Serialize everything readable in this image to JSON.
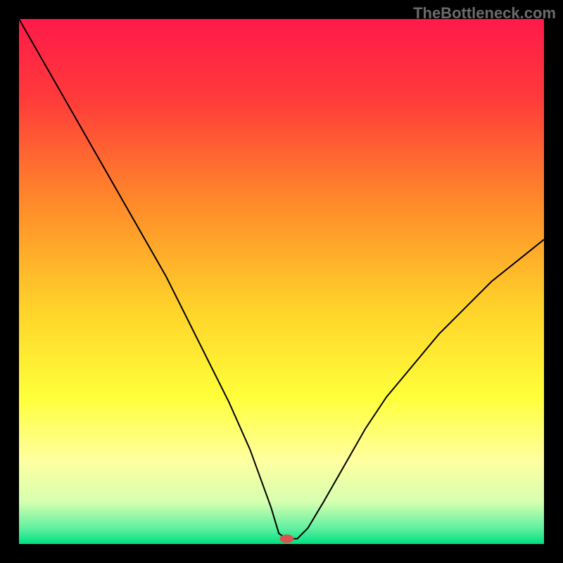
{
  "attribution": "TheBottleneck.com",
  "chart_data": {
    "type": "line",
    "title": "",
    "xlabel": "",
    "ylabel": "",
    "xlim": [
      0,
      100
    ],
    "ylim": [
      0,
      100
    ],
    "background_gradient": {
      "stops": [
        {
          "t": 0.0,
          "color": "#ff1a4a"
        },
        {
          "t": 0.15,
          "color": "#ff3a3a"
        },
        {
          "t": 0.35,
          "color": "#ff8a2a"
        },
        {
          "t": 0.55,
          "color": "#ffd22a"
        },
        {
          "t": 0.72,
          "color": "#ffff3a"
        },
        {
          "t": 0.84,
          "color": "#ffffa0"
        },
        {
          "t": 0.92,
          "color": "#d6ffb0"
        },
        {
          "t": 0.97,
          "color": "#60f0a0"
        },
        {
          "t": 1.0,
          "color": "#00e080"
        }
      ]
    },
    "series": [
      {
        "name": "bottleneck-curve",
        "color": "#000000",
        "stroke_width": 2,
        "x": [
          0,
          4,
          8,
          12,
          16,
          20,
          24,
          28,
          32,
          36,
          40,
          44,
          48,
          49.5,
          51,
          52,
          53,
          55,
          58,
          62,
          66,
          70,
          75,
          80,
          85,
          90,
          95,
          100
        ],
        "y": [
          100,
          93,
          86,
          79,
          72,
          65,
          58,
          51,
          43,
          35,
          27,
          18,
          7,
          2,
          1,
          1,
          1,
          3,
          8,
          15,
          22,
          28,
          34,
          40,
          45,
          50,
          54,
          58
        ]
      }
    ],
    "marker": {
      "name": "optimal-point",
      "x": 51,
      "y": 1,
      "color": "#d9534f",
      "rx": 10,
      "ry": 6
    }
  }
}
